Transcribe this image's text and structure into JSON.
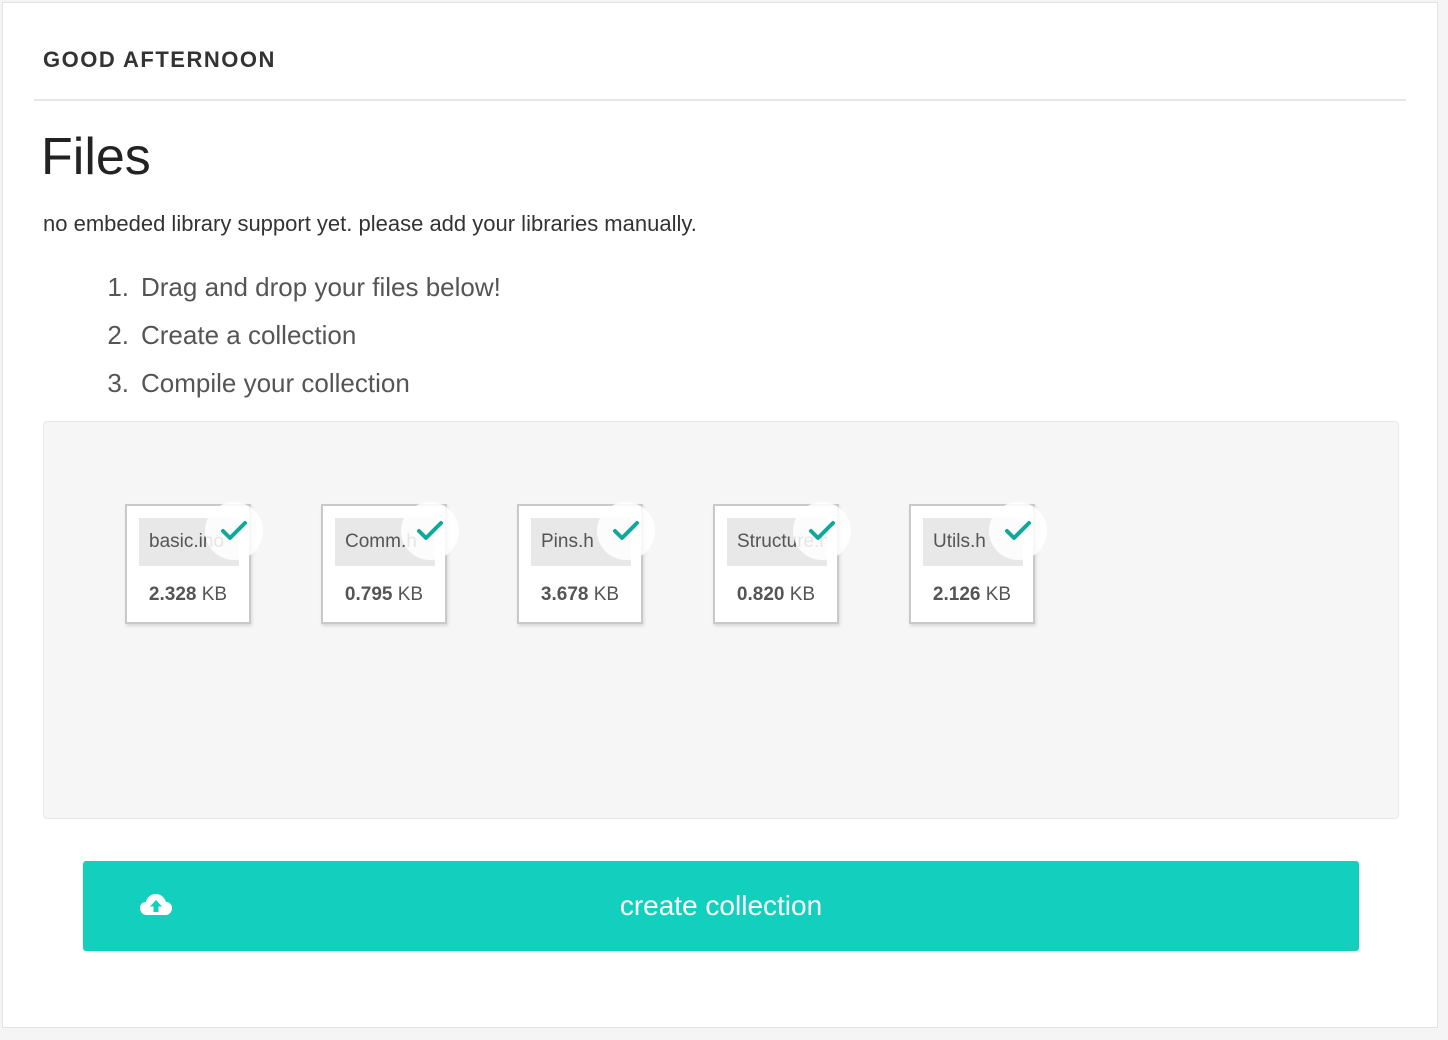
{
  "header": {
    "greeting": "GOOD AFTERNOON"
  },
  "page": {
    "title": "Files",
    "notice": "no embeded library support yet. please add your libraries manually."
  },
  "steps": [
    {
      "num": "1.",
      "text": "Drag and drop your files below!"
    },
    {
      "num": "2.",
      "text": "Create a collection"
    },
    {
      "num": "3.",
      "text": "Compile your collection"
    }
  ],
  "files": [
    {
      "name": "basic.ino",
      "size": "2.328",
      "unit": "KB",
      "status": "uploaded",
      "icon": "check-icon"
    },
    {
      "name": "Comm.h",
      "size": "0.795",
      "unit": "KB",
      "status": "uploaded",
      "icon": "check-icon"
    },
    {
      "name": "Pins.h",
      "size": "3.678",
      "unit": "KB",
      "status": "uploaded",
      "icon": "check-icon"
    },
    {
      "name": "Structure.h",
      "size": "0.820",
      "unit": "KB",
      "status": "uploaded",
      "icon": "check-icon"
    },
    {
      "name": "Utils.h",
      "size": "2.126",
      "unit": "KB",
      "status": "uploaded",
      "icon": "check-icon"
    }
  ],
  "actions": {
    "create_label": "create collection",
    "create_icon": "cloud-upload-icon"
  },
  "colors": {
    "accent": "#12cfbe",
    "check": "#0fa89a"
  }
}
